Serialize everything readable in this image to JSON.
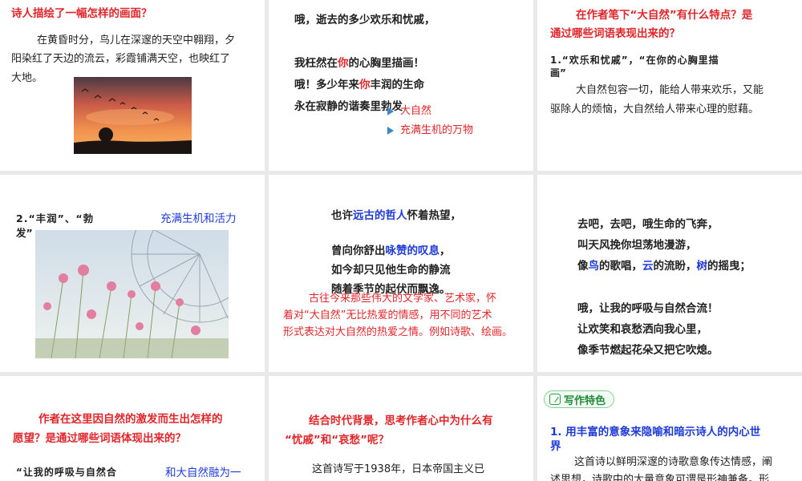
{
  "slide1": {
    "question": "诗人描绘了一幅怎样的画面？",
    "answer": [
      "在黄昏时分，鸟儿在深邃的天空中翱翔，夕",
      "阳染红了天边的流云，彩霞铺满天空，也映红了",
      "大地。"
    ]
  },
  "slide2": {
    "lines": [
      "哦，逝去的多少欢乐和忧戚，",
      "我枉然在",
      "你",
      "的心胸里描画！",
      "哦！多少年来",
      "你",
      "丰润的生命",
      "永在寂静的谐奏里勃发"
    ],
    "bullets": [
      "大自然",
      "充满生机的万物"
    ]
  },
  "slide3": {
    "question_l1": "在作者笔下“大自然”有什么特点？是",
    "question_l2": "通过哪些词语表现出来的？",
    "item_l1": "1.“欢乐和忧戚”，“在你的心胸里描",
    "item_l2": "画”",
    "answer_l1": "大自然包容一切，能给人带来欢乐，又能",
    "answer_l2": "驱除人的烦恼，大自然给人带来心理的慰藉。"
  },
  "slide4": {
    "item_l1": "2.“丰润”、“勃",
    "item_l2": "发”",
    "answer": "充满生机和活力"
  },
  "slide5": {
    "l1a": "也许",
    "l1b": "远古的哲人",
    "l1c": "怀着热望，",
    "l2a": "曾向你舒出",
    "l2b": "咏赞的叹息",
    "l2c": "，",
    "l3": "如今却只见他生命的静流",
    "l4": "随着季节的起伏而飘逸。",
    "note": [
      "古往今来那些伟大的文学家、艺术家，怀",
      "着对“大自然”无比热爱的情感，用不同的艺术",
      "形式表达对大自然的热爱之情。例如诗歌、绘画。"
    ]
  },
  "slide6": {
    "l1": "去吧，去吧，哦生命的飞奔，",
    "l2": "叫天风挽你坦荡地漫游，",
    "l3a": "像",
    "l3b": "鸟",
    "l3c": "的歌唱，",
    "l3d": "云",
    "l3e": "的流盼，",
    "l3f": "树",
    "l3g": "的摇曳；",
    "l4": "哦，让我的呼吸与自然合流！",
    "l5": "让欢笑和哀愁洒向我心里，",
    "l6": "像季节燃起花朵又把它吹熄。"
  },
  "slide7": {
    "question_l1": "作者在这里因自然的激发而生出怎样的",
    "question_l2": "愿望？是通过哪些词语体现出来的？",
    "quote": "“让我的呼吸与自然合",
    "answer": "和大自然融为一"
  },
  "slide8": {
    "question_l1": "结合时代背景，思考作者心中为什么有",
    "question_l2": "“忧戚”和“哀愁”呢？",
    "body": "这首诗写于1938年，日本帝国主义已"
  },
  "slide9": {
    "tag": "写作特色",
    "heading_l1": "1. 用丰富的意象来隐喻和暗示诗人的内心世",
    "heading_l2": "界",
    "body_l1": "这首诗以鲜明深邃的诗歌意象传达情感，阐",
    "body_l2": "述思想，诗歌中的大量意象可谓是形神兼备。形"
  },
  "colors": {
    "red": "#e0262a",
    "blue": "#1f3bd6",
    "green": "#1f8a3a",
    "bullet": "#3b86c9"
  }
}
